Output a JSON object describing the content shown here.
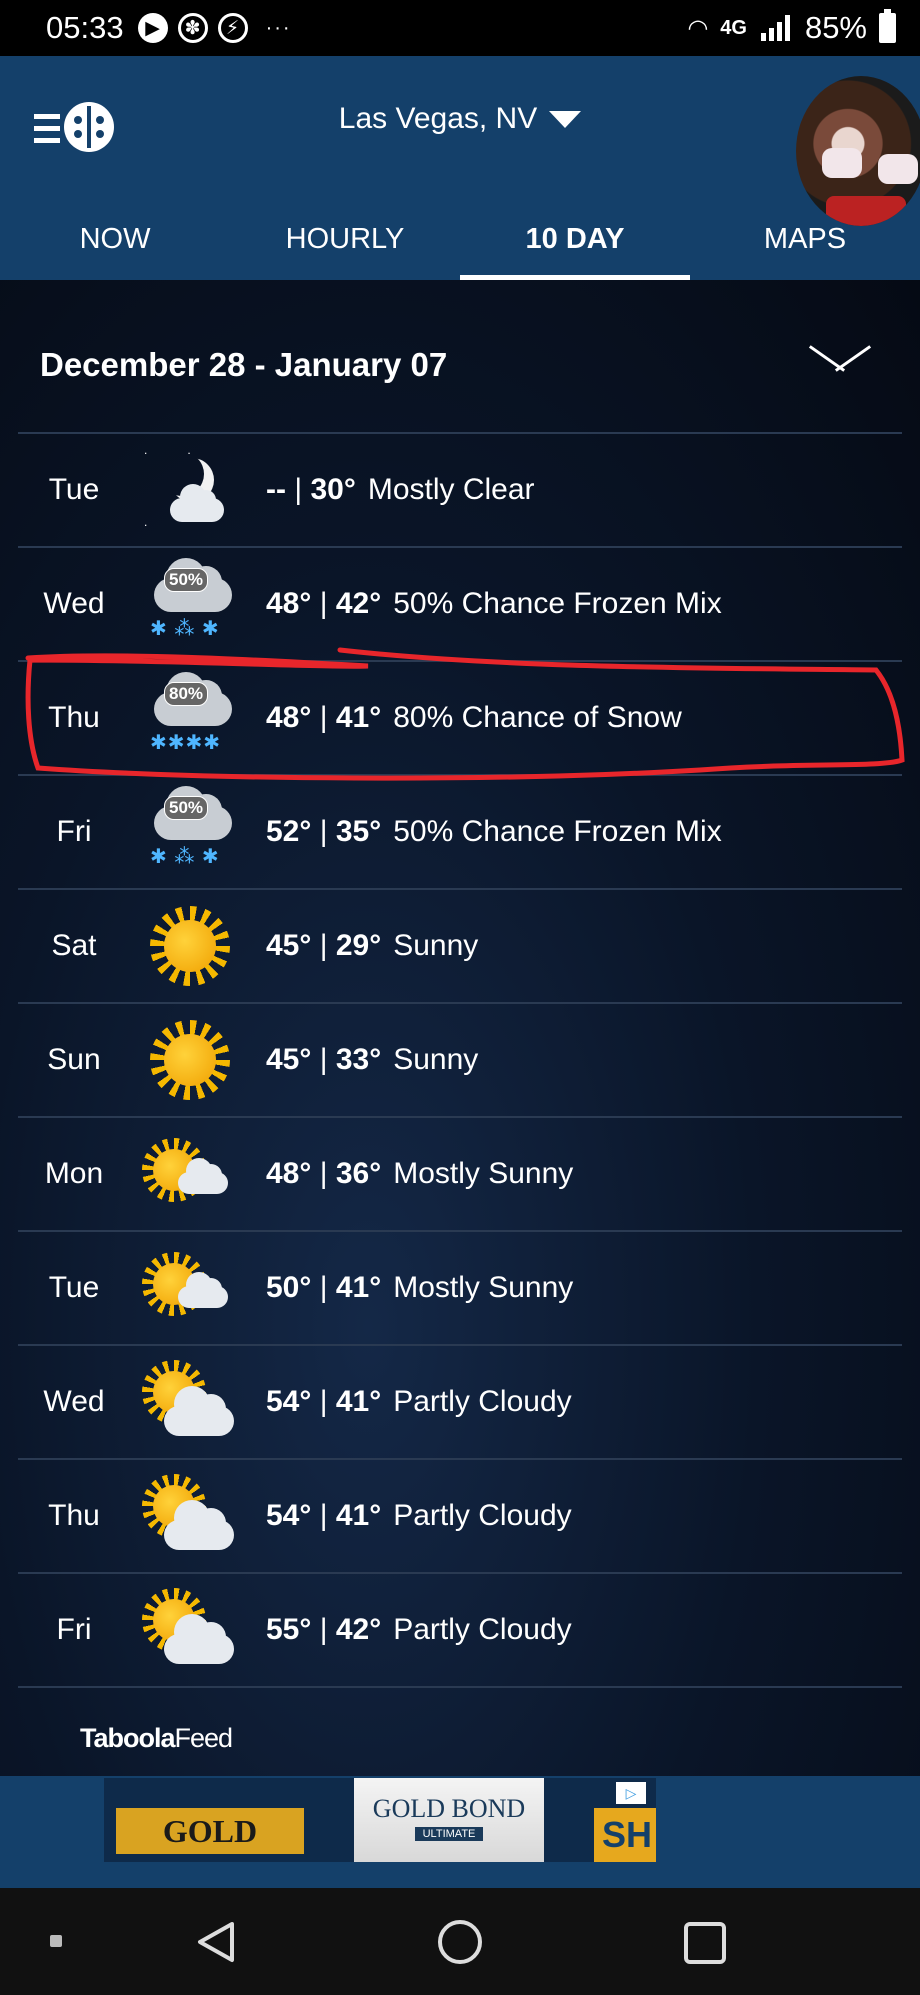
{
  "status_bar": {
    "time": "05:33",
    "dots": "···",
    "network": "4G",
    "battery": "85%"
  },
  "header": {
    "location": "Las Vegas, NV",
    "tabs": [
      {
        "label": "NOW",
        "active": false
      },
      {
        "label": "HOURLY",
        "active": false
      },
      {
        "label": "10 DAY",
        "active": true
      },
      {
        "label": "MAPS",
        "active": false
      }
    ]
  },
  "range": {
    "title": "December 28 - January 07"
  },
  "forecast": [
    {
      "day": "Tue",
      "high": "--",
      "low": "30°",
      "condition": "Mostly Clear",
      "icon": "night-mostly-clear-icon"
    },
    {
      "day": "Wed",
      "high": "48°",
      "low": "42°",
      "condition": "50% Chance Frozen Mix",
      "icon": "frozen-mix-icon",
      "precip": "50%"
    },
    {
      "day": "Thu",
      "high": "48°",
      "low": "41°",
      "condition": "80% Chance of Snow",
      "icon": "snow-icon",
      "precip": "80%"
    },
    {
      "day": "Fri",
      "high": "52°",
      "low": "35°",
      "condition": "50% Chance Frozen Mix",
      "icon": "frozen-mix-icon",
      "precip": "50%"
    },
    {
      "day": "Sat",
      "high": "45°",
      "low": "29°",
      "condition": "Sunny",
      "icon": "sunny-icon"
    },
    {
      "day": "Sun",
      "high": "45°",
      "low": "33°",
      "condition": "Sunny",
      "icon": "sunny-icon"
    },
    {
      "day": "Mon",
      "high": "48°",
      "low": "36°",
      "condition": "Mostly Sunny",
      "icon": "mostly-sunny-icon"
    },
    {
      "day": "Tue",
      "high": "50°",
      "low": "41°",
      "condition": "Mostly Sunny",
      "icon": "mostly-sunny-icon"
    },
    {
      "day": "Wed",
      "high": "54°",
      "low": "41°",
      "condition": "Partly Cloudy",
      "icon": "partly-cloudy-icon"
    },
    {
      "day": "Thu",
      "high": "54°",
      "low": "41°",
      "condition": "Partly Cloudy",
      "icon": "partly-cloudy-icon"
    },
    {
      "day": "Fri",
      "high": "55°",
      "low": "42°",
      "condition": "Partly Cloudy",
      "icon": "partly-cloudy-icon"
    }
  ],
  "feed": {
    "brand_bold": "Taboola",
    "brand_light": "Feed"
  },
  "ad": {
    "brand": "GOLD BOND",
    "bottle_brand": "GOLD BOND",
    "bottle_line": "ULTIMATE",
    "cta_partial": "SH"
  },
  "colors": {
    "header_bg": "#14406a",
    "annotation_red": "#e8262b"
  }
}
